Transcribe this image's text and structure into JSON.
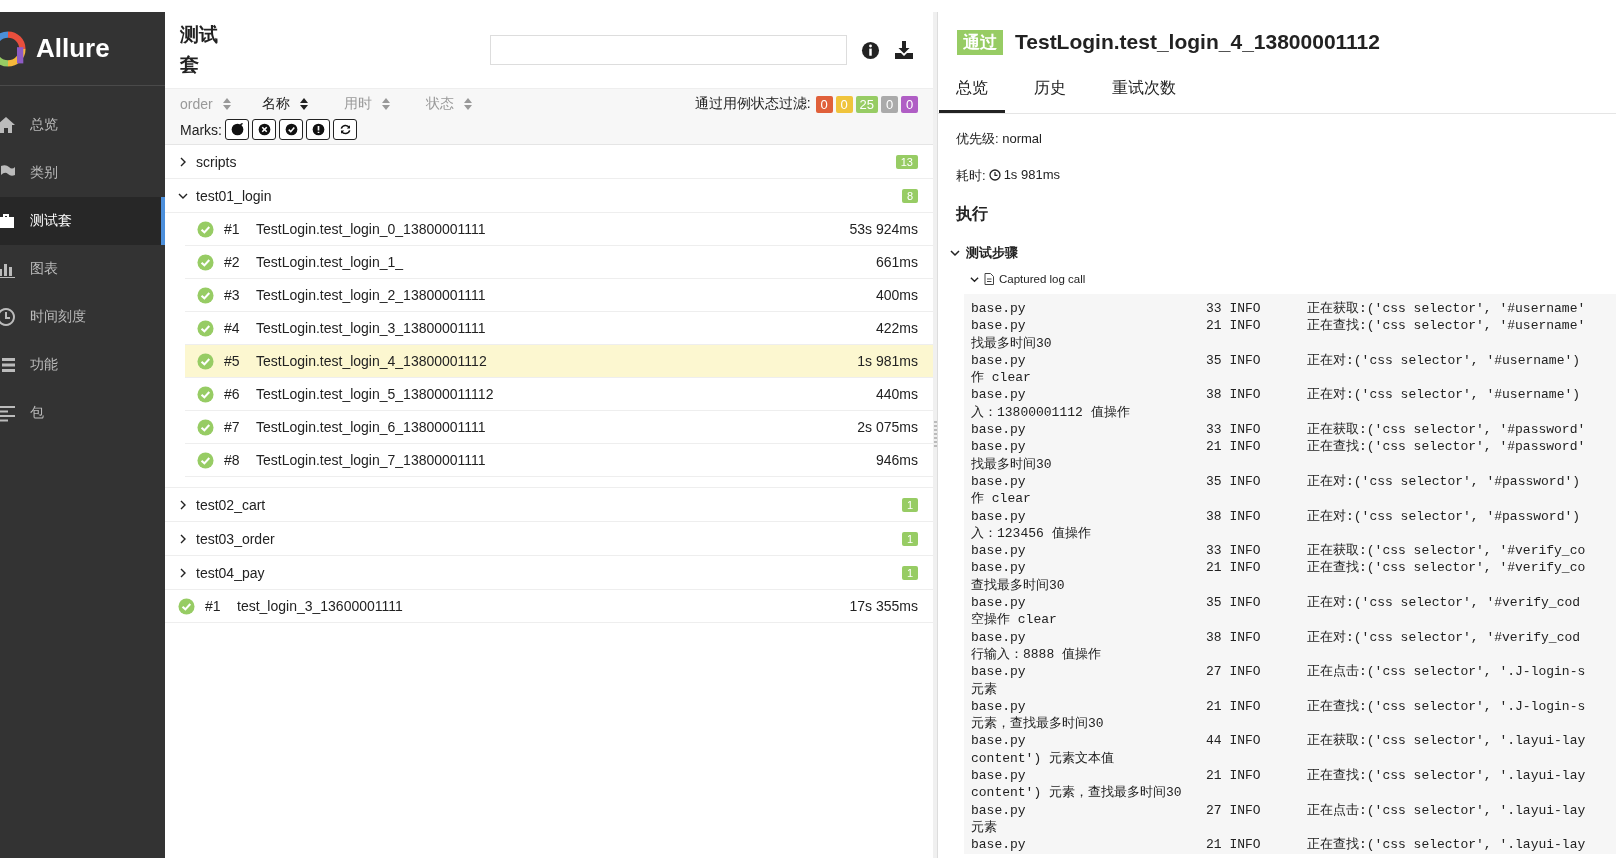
{
  "sidebar": {
    "brand": "Allure",
    "items": [
      {
        "label": "总览",
        "selected": false
      },
      {
        "label": "类别",
        "selected": false
      },
      {
        "label": "测试套",
        "selected": true
      },
      {
        "label": "图表",
        "selected": false
      },
      {
        "label": "时间刻度",
        "selected": false
      },
      {
        "label": "功能",
        "selected": false
      },
      {
        "label": "包",
        "selected": false
      }
    ]
  },
  "suites": {
    "title": "测试套",
    "sort_columns": [
      {
        "label": "order",
        "selected": false
      },
      {
        "label": "名称",
        "selected": true
      },
      {
        "label": "用时",
        "selected": false
      },
      {
        "label": "状态",
        "selected": false
      }
    ],
    "filter_label": "通过用例状态过滤:",
    "status_filters": [
      {
        "count": "0",
        "color": "#e0603a"
      },
      {
        "count": "0",
        "color": "#f0c43c"
      },
      {
        "count": "25",
        "color": "#97cc64"
      },
      {
        "count": "0",
        "color": "#aaaaaa"
      },
      {
        "count": "0",
        "color": "#b05ec5"
      }
    ],
    "marks_label": "Marks:",
    "tree": [
      {
        "kind": "group",
        "name": "scripts",
        "expanded": false,
        "count": "13"
      },
      {
        "kind": "group",
        "name": "test01_login",
        "expanded": true,
        "count": "8",
        "children": [
          {
            "number": "#1",
            "name": "TestLogin.test_login_0_13800001111",
            "duration": "53s 924ms",
            "selected": false
          },
          {
            "number": "#2",
            "name": "TestLogin.test_login_1_",
            "duration": "661ms",
            "selected": false
          },
          {
            "number": "#3",
            "name": "TestLogin.test_login_2_13800001111",
            "duration": "400ms",
            "selected": false
          },
          {
            "number": "#4",
            "name": "TestLogin.test_login_3_13800001111",
            "duration": "422ms",
            "selected": false
          },
          {
            "number": "#5",
            "name": "TestLogin.test_login_4_13800001112",
            "duration": "1s 981ms",
            "selected": true
          },
          {
            "number": "#6",
            "name": "TestLogin.test_login_5_138000011112",
            "duration": "440ms",
            "selected": false
          },
          {
            "number": "#7",
            "name": "TestLogin.test_login_6_13800001111",
            "duration": "2s 075ms",
            "selected": false
          },
          {
            "number": "#8",
            "name": "TestLogin.test_login_7_13800001111",
            "duration": "946ms",
            "selected": false
          }
        ]
      },
      {
        "kind": "group",
        "name": "test02_cart",
        "expanded": false,
        "count": "1"
      },
      {
        "kind": "group",
        "name": "test03_order",
        "expanded": false,
        "count": "1"
      },
      {
        "kind": "group",
        "name": "test04_pay",
        "expanded": false,
        "count": "1"
      },
      {
        "kind": "test",
        "number": "#1",
        "name": "test_login_3_13600001111",
        "duration": "17s 355ms",
        "selected": false
      }
    ]
  },
  "detail": {
    "status": "通过",
    "title": "TestLogin.test_login_4_13800001112",
    "tabs": [
      {
        "label": "总览",
        "selected": true
      },
      {
        "label": "历史",
        "selected": false
      },
      {
        "label": "重试次数",
        "selected": false
      }
    ],
    "priority": "优先级: normal",
    "duration_label": "耗时:",
    "duration": "1s 981ms",
    "section": "执行",
    "steps_title": "测试步骤",
    "steps_expanded": true,
    "attachment": {
      "title": "Captured log call",
      "expanded": true
    },
    "log": [
      {
        "file": "base.py",
        "line": "33",
        "level": "INFO",
        "message": "正在获取:('css selector', '#username'"
      },
      {
        "file": "base.py",
        "line": "21",
        "level": "INFO",
        "message": "正在查找:('css selector', '#username'",
        "wrap": "找最多时间30"
      },
      {
        "file": "base.py",
        "line": "35",
        "level": "INFO",
        "message": "正在对:('css selector', '#username')",
        "wrap": "作 clear"
      },
      {
        "file": "base.py",
        "line": "38",
        "level": "INFO",
        "message": "正在对:('css selector', '#username')",
        "wrap": "入：13800001112 值操作"
      },
      {
        "file": "base.py",
        "line": "33",
        "level": "INFO",
        "message": "正在获取:('css selector', '#password'"
      },
      {
        "file": "base.py",
        "line": "21",
        "level": "INFO",
        "message": "正在查找:('css selector', '#password'",
        "wrap": "找最多时间30"
      },
      {
        "file": "base.py",
        "line": "35",
        "level": "INFO",
        "message": "正在对:('css selector', '#password')",
        "wrap": "作 clear"
      },
      {
        "file": "base.py",
        "line": "38",
        "level": "INFO",
        "message": "正在对:('css selector', '#password')",
        "wrap": "入：123456 值操作"
      },
      {
        "file": "base.py",
        "line": "33",
        "level": "INFO",
        "message": "正在获取:('css selector', '#verify_co"
      },
      {
        "file": "base.py",
        "line": "21",
        "level": "INFO",
        "message": "正在查找:('css selector', '#verify_co",
        "wrap": "查找最多时间30"
      },
      {
        "file": "base.py",
        "line": "35",
        "level": "INFO",
        "message": "正在对:('css selector', '#verify_cod",
        "wrap": "空操作 clear"
      },
      {
        "file": "base.py",
        "line": "38",
        "level": "INFO",
        "message": "正在对:('css selector', '#verify_cod",
        "wrap": "行输入：8888 值操作"
      },
      {
        "file": "base.py",
        "line": "27",
        "level": "INFO",
        "message": "正在点击:('css selector', '.J-login-s",
        "wrap": "元素"
      },
      {
        "file": "base.py",
        "line": "21",
        "level": "INFO",
        "message": "正在查找:('css selector', '.J-login-s",
        "wrap": "元素，查找最多时间30"
      },
      {
        "file": "base.py",
        "line": "44",
        "level": "INFO",
        "message": "正在获取:('css selector', '.layui-lay",
        "wrap": "content') 元素文本值"
      },
      {
        "file": "base.py",
        "line": "21",
        "level": "INFO",
        "message": "正在查找:('css selector', '.layui-lay",
        "wrap": "content') 元素，查找最多时间30"
      },
      {
        "file": "base.py",
        "line": "27",
        "level": "INFO",
        "message": "正在点击:('css selector', '.layui-lay",
        "wrap": "元素"
      },
      {
        "file": "base.py",
        "line": "21",
        "level": "INFO",
        "message": "正在查找:('css selector', '.layui-lay"
      }
    ]
  }
}
